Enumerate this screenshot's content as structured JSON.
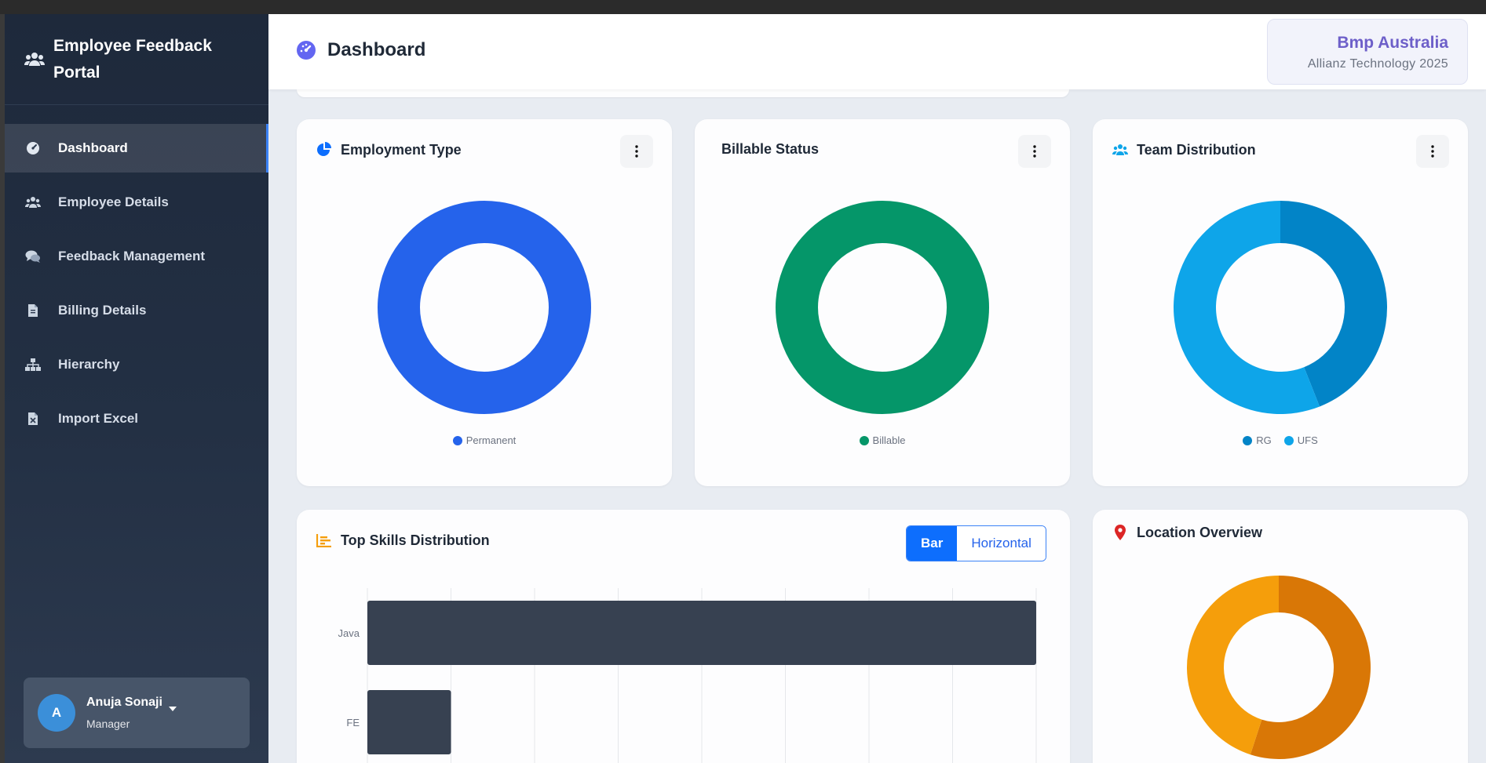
{
  "app": {
    "title": "Employee Feedback Portal"
  },
  "sidebar": {
    "items": [
      {
        "label": "Dashboard",
        "icon": "gauge-icon",
        "active": true
      },
      {
        "label": "Employee Details",
        "icon": "users-icon"
      },
      {
        "label": "Feedback Management",
        "icon": "comments-icon"
      },
      {
        "label": "Billing Details",
        "icon": "invoice-icon"
      },
      {
        "label": "Hierarchy",
        "icon": "sitemap-icon"
      },
      {
        "label": "Import Excel",
        "icon": "excel-file-icon"
      }
    ],
    "user": {
      "initial": "A",
      "name": "Anuja Sonaji",
      "role": "Manager"
    }
  },
  "header": {
    "title": "Dashboard",
    "company": "Bmp Australia",
    "subtitle": "Allianz Technology 2025"
  },
  "cards": {
    "employment": {
      "title": "Employment Type"
    },
    "billable": {
      "title": "Billable Status"
    },
    "team": {
      "title": "Team Distribution"
    },
    "skills": {
      "title": "Top Skills Distribution",
      "toggle": [
        "Bar",
        "Horizontal"
      ],
      "toggle_active": "Bar"
    },
    "location": {
      "title": "Location Overview"
    }
  },
  "colors": {
    "accent": "#0d6efd",
    "permanent": "#2563eb",
    "billable": "#059669",
    "rg": "#0284c7",
    "ufs": "#0ea5e9",
    "location_a": "#d97706",
    "location_b": "#f59e0b",
    "bar": "#374151"
  },
  "chart_data": [
    {
      "type": "pie",
      "title": "Employment Type",
      "labels": [
        "Permanent"
      ],
      "values": [
        100
      ]
    },
    {
      "type": "pie",
      "title": "Billable Status",
      "labels": [
        "Billable"
      ],
      "values": [
        100
      ]
    },
    {
      "type": "pie",
      "title": "Team Distribution",
      "labels": [
        "RG",
        "UFS"
      ],
      "values": [
        44,
        56
      ]
    },
    {
      "type": "bar",
      "orientation": "horizontal",
      "title": "Top Skills Distribution",
      "categories": [
        "Java",
        "FE"
      ],
      "values": [
        8,
        1
      ],
      "xlim": [
        0,
        8
      ],
      "grid": true
    },
    {
      "type": "pie",
      "title": "Location Overview",
      "labels": [
        "",
        ""
      ],
      "values": [
        55,
        45
      ]
    }
  ]
}
